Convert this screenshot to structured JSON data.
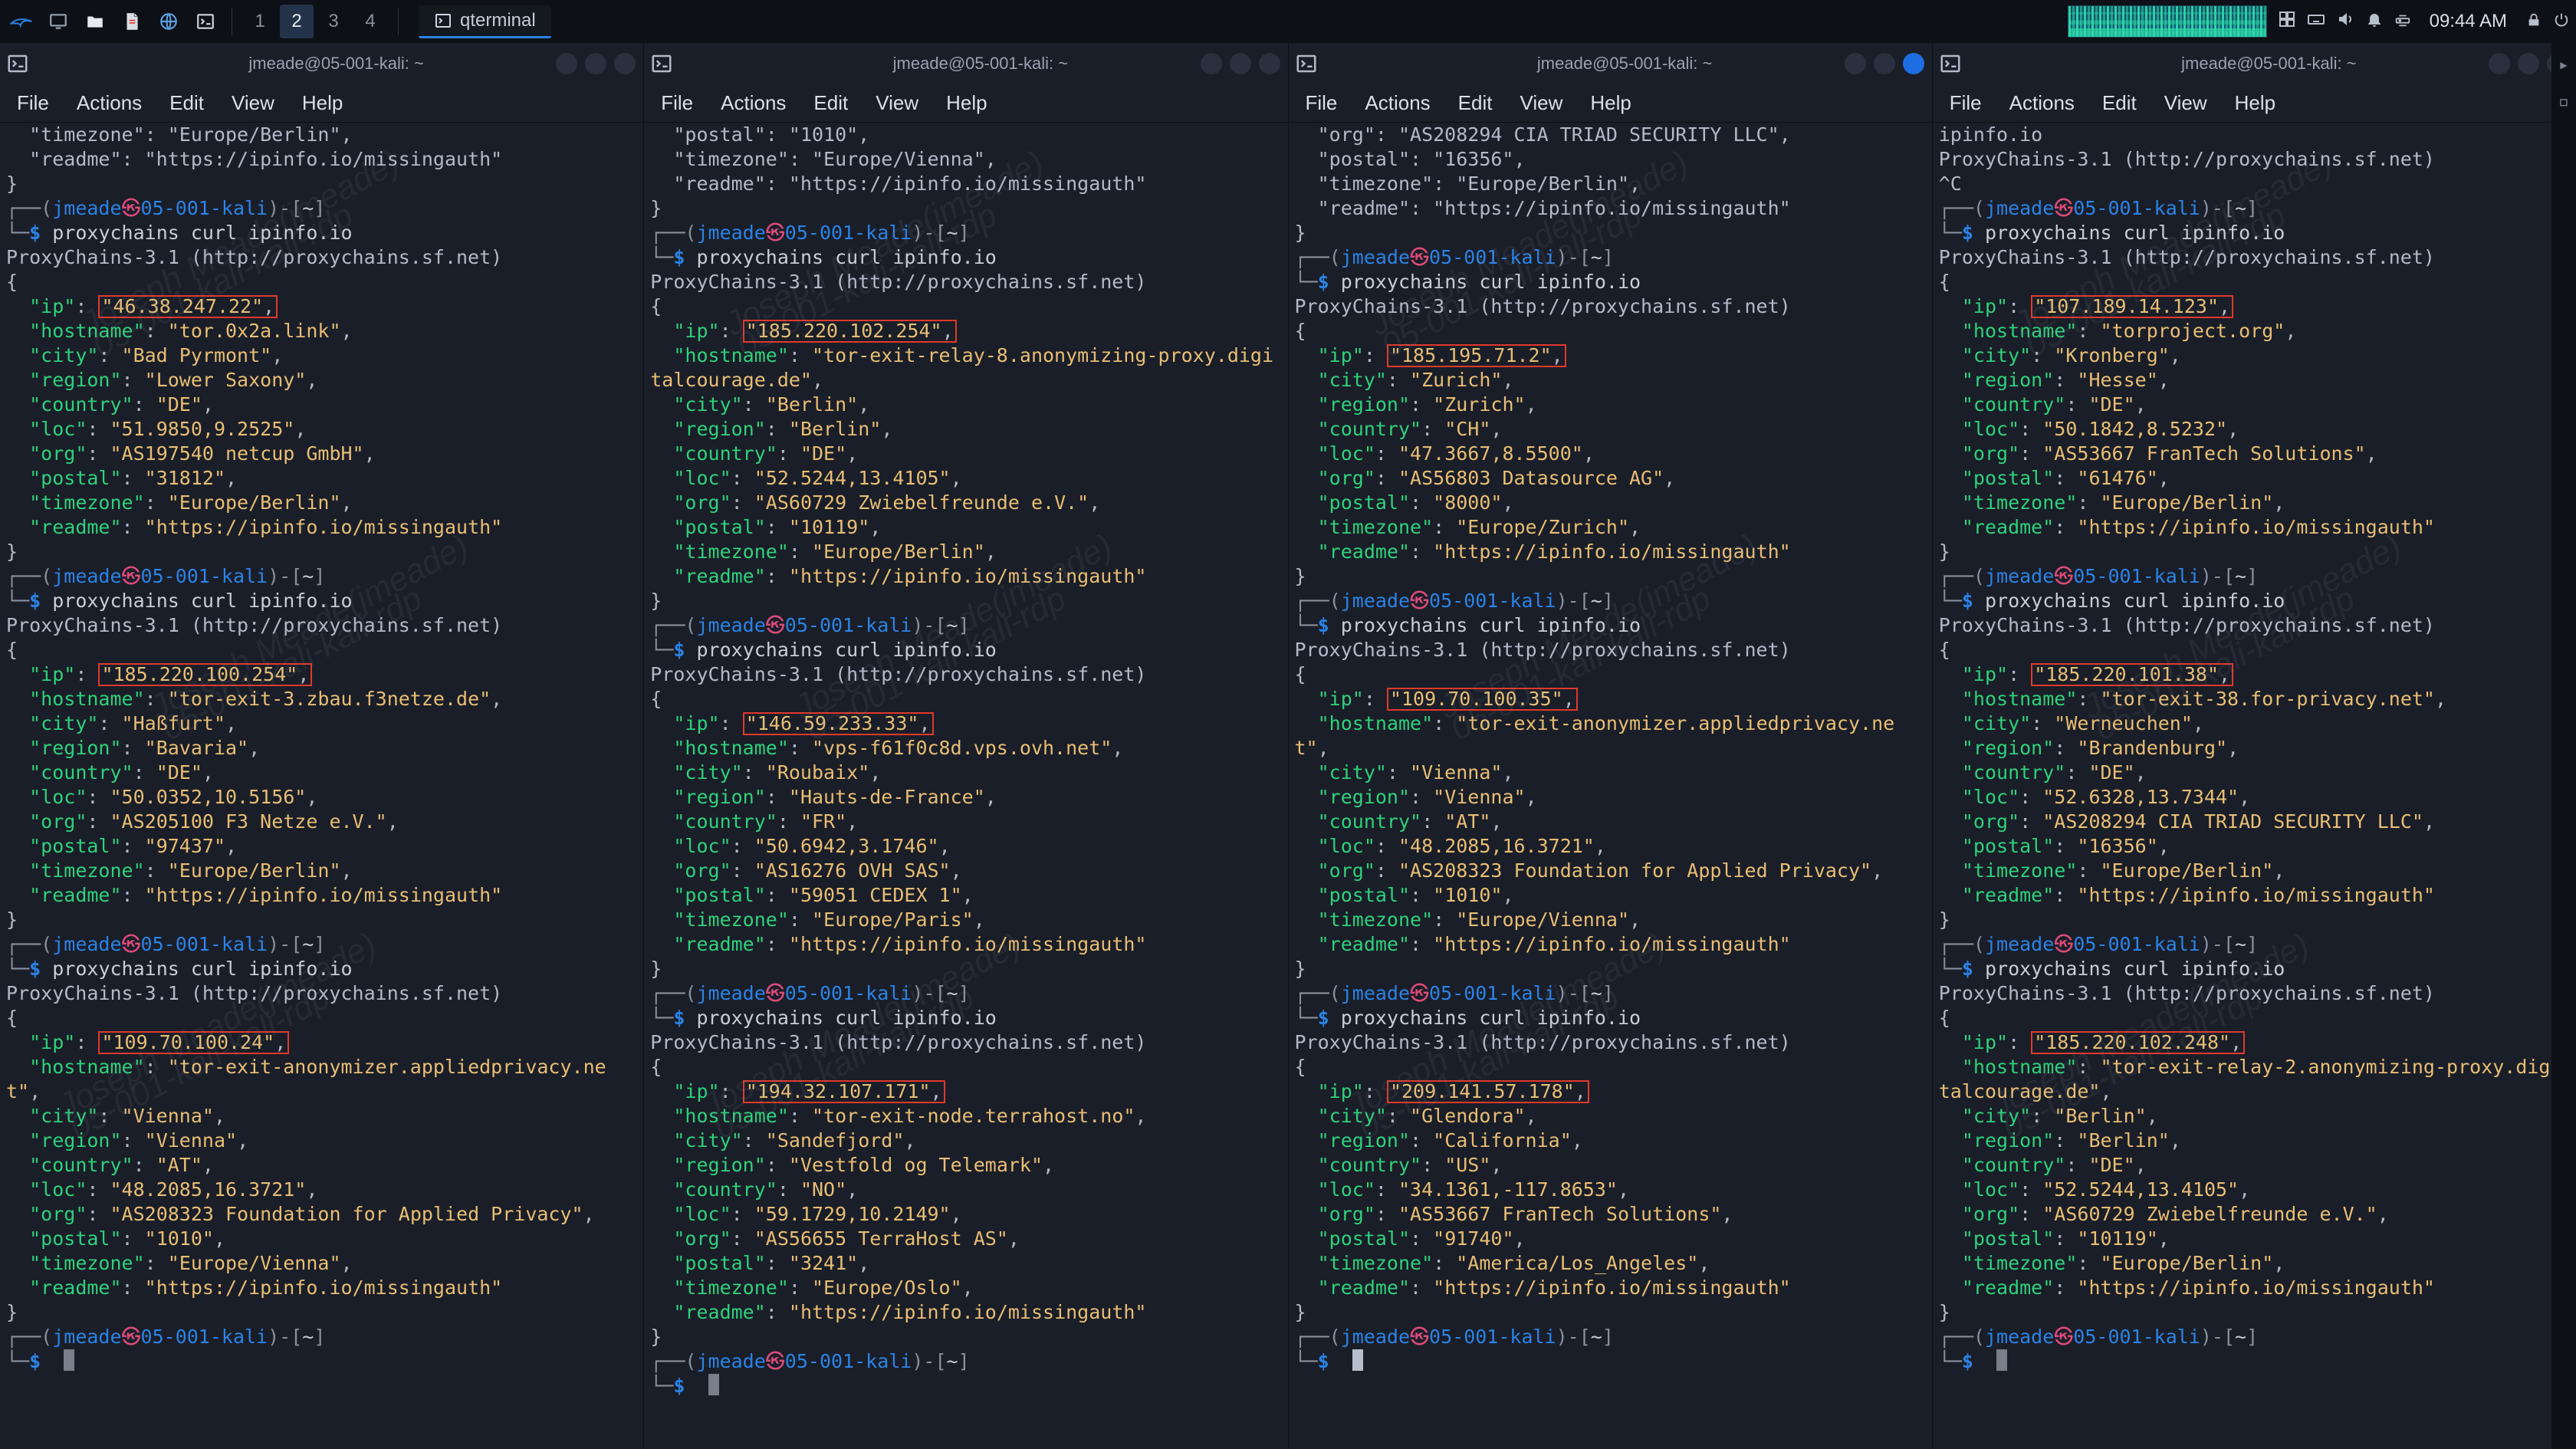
{
  "taskbar": {
    "workspaces": [
      "1",
      "2",
      "3",
      "4"
    ],
    "active_workspace_index": 1,
    "app_title": "qterminal",
    "clock": "09:44 AM"
  },
  "menus": {
    "file": "File",
    "actions": "Actions",
    "edit": "Edit",
    "view": "View",
    "help": "Help"
  },
  "watermark_a": "Joseph Meade(jmeade)",
  "watermark_b": "05-001-kali-kali-rdp",
  "prompt": {
    "user": "jmeade",
    "host": "05-001-kali",
    "path": "~",
    "sigil": "$"
  },
  "command": "proxychains curl ipinfo.io",
  "pc_banner": "ProxyChains-3.1 (http://proxychains.sf.net)",
  "panes": [
    {
      "title": "jmeade@05-001-kali: ~",
      "close_highlight": false,
      "pre_lines": [
        "  \"timezone\": \"Europe/Berlin\",",
        "  \"readme\": \"https://ipinfo.io/missingauth\"",
        "}"
      ],
      "blocks": [
        {
          "ip": "46.38.247.22",
          "fields": [
            [
              "hostname",
              "tor.0x2a.link"
            ],
            [
              "city",
              "Bad Pyrmont"
            ],
            [
              "region",
              "Lower Saxony"
            ],
            [
              "country",
              "DE"
            ],
            [
              "loc",
              "51.9850,9.2525"
            ],
            [
              "org",
              "AS197540 netcup GmbH"
            ],
            [
              "postal",
              "31812"
            ],
            [
              "timezone",
              "Europe/Berlin"
            ],
            [
              "readme",
              "https://ipinfo.io/missingauth"
            ]
          ]
        },
        {
          "ip": "185.220.100.254",
          "fields": [
            [
              "hostname",
              "tor-exit-3.zbau.f3netze.de"
            ],
            [
              "city",
              "Haßfurt"
            ],
            [
              "region",
              "Bavaria"
            ],
            [
              "country",
              "DE"
            ],
            [
              "loc",
              "50.0352,10.5156"
            ],
            [
              "org",
              "AS205100 F3 Netze e.V."
            ],
            [
              "postal",
              "97437"
            ],
            [
              "timezone",
              "Europe/Berlin"
            ],
            [
              "readme",
              "https://ipinfo.io/missingauth"
            ]
          ]
        },
        {
          "ip": "109.70.100.24",
          "fields": [
            [
              "hostname",
              "tor-exit-anonymizer.appliedprivacy.net"
            ],
            [
              "city",
              "Vienna"
            ],
            [
              "region",
              "Vienna"
            ],
            [
              "country",
              "AT"
            ],
            [
              "loc",
              "48.2085,16.3721"
            ],
            [
              "org",
              "AS208323 Foundation for Applied Privacy"
            ],
            [
              "postal",
              "1010"
            ],
            [
              "timezone",
              "Europe/Vienna"
            ],
            [
              "readme",
              "https://ipinfo.io/missingauth"
            ]
          ]
        }
      ],
      "trailing_prompt": true,
      "solid_cursor": false
    },
    {
      "title": "jmeade@05-001-kali: ~",
      "close_highlight": false,
      "pre_lines": [
        "  \"postal\": \"1010\",",
        "  \"timezone\": \"Europe/Vienna\",",
        "  \"readme\": \"https://ipinfo.io/missingauth\"",
        "}"
      ],
      "blocks": [
        {
          "ip": "185.220.102.254",
          "fields": [
            [
              "hostname",
              "tor-exit-relay-8.anonymizing-proxy.digitalcourage.de"
            ],
            [
              "city",
              "Berlin"
            ],
            [
              "region",
              "Berlin"
            ],
            [
              "country",
              "DE"
            ],
            [
              "loc",
              "52.5244,13.4105"
            ],
            [
              "org",
              "AS60729 Zwiebelfreunde e.V."
            ],
            [
              "postal",
              "10119"
            ],
            [
              "timezone",
              "Europe/Berlin"
            ],
            [
              "readme",
              "https://ipinfo.io/missingauth"
            ]
          ]
        },
        {
          "ip": "146.59.233.33",
          "fields": [
            [
              "hostname",
              "vps-f61f0c8d.vps.ovh.net"
            ],
            [
              "city",
              "Roubaix"
            ],
            [
              "region",
              "Hauts-de-France"
            ],
            [
              "country",
              "FR"
            ],
            [
              "loc",
              "50.6942,3.1746"
            ],
            [
              "org",
              "AS16276 OVH SAS"
            ],
            [
              "postal",
              "59051 CEDEX 1"
            ],
            [
              "timezone",
              "Europe/Paris"
            ],
            [
              "readme",
              "https://ipinfo.io/missingauth"
            ]
          ]
        },
        {
          "ip": "194.32.107.171",
          "fields": [
            [
              "hostname",
              "tor-exit-node.terrahost.no"
            ],
            [
              "city",
              "Sandefjord"
            ],
            [
              "region",
              "Vestfold og Telemark"
            ],
            [
              "country",
              "NO"
            ],
            [
              "loc",
              "59.1729,10.2149"
            ],
            [
              "org",
              "AS56655 TerraHost AS"
            ],
            [
              "postal",
              "3241"
            ],
            [
              "timezone",
              "Europe/Oslo"
            ],
            [
              "readme",
              "https://ipinfo.io/missingauth"
            ]
          ]
        }
      ],
      "trailing_prompt": true,
      "solid_cursor": false
    },
    {
      "title": "jmeade@05-001-kali: ~",
      "close_highlight": true,
      "pre_lines": [
        "  \"org\": \"AS208294 CIA TRIAD SECURITY LLC\",",
        "  \"postal\": \"16356\",",
        "  \"timezone\": \"Europe/Berlin\",",
        "  \"readme\": \"https://ipinfo.io/missingauth\"",
        "}"
      ],
      "blocks": [
        {
          "ip": "185.195.71.2",
          "fields": [
            [
              "city",
              "Zurich"
            ],
            [
              "region",
              "Zurich"
            ],
            [
              "country",
              "CH"
            ],
            [
              "loc",
              "47.3667,8.5500"
            ],
            [
              "org",
              "AS56803 Datasource AG"
            ],
            [
              "postal",
              "8000"
            ],
            [
              "timezone",
              "Europe/Zurich"
            ],
            [
              "readme",
              "https://ipinfo.io/missingauth"
            ]
          ]
        },
        {
          "ip": "109.70.100.35",
          "fields": [
            [
              "hostname",
              "tor-exit-anonymizer.appliedprivacy.net"
            ],
            [
              "city",
              "Vienna"
            ],
            [
              "region",
              "Vienna"
            ],
            [
              "country",
              "AT"
            ],
            [
              "loc",
              "48.2085,16.3721"
            ],
            [
              "org",
              "AS208323 Foundation for Applied Privacy"
            ],
            [
              "postal",
              "1010"
            ],
            [
              "timezone",
              "Europe/Vienna"
            ],
            [
              "readme",
              "https://ipinfo.io/missingauth"
            ]
          ]
        },
        {
          "ip": "209.141.57.178",
          "fields": [
            [
              "city",
              "Glendora"
            ],
            [
              "region",
              "California"
            ],
            [
              "country",
              "US"
            ],
            [
              "loc",
              "34.1361,-117.8653"
            ],
            [
              "org",
              "AS53667 FranTech Solutions"
            ],
            [
              "postal",
              "91740"
            ],
            [
              "timezone",
              "America/Los_Angeles"
            ],
            [
              "readme",
              "https://ipinfo.io/missingauth"
            ]
          ]
        }
      ],
      "trailing_prompt": true,
      "solid_cursor": true
    },
    {
      "title": "jmeade@05-001-kali: ~",
      "close_highlight": false,
      "pre_lines": [
        "ipinfo.io",
        "ProxyChains-3.1 (http://proxychains.sf.net)",
        "^C"
      ],
      "blocks": [
        {
          "ip": "107.189.14.123",
          "fields": [
            [
              "hostname",
              "torproject.org"
            ],
            [
              "city",
              "Kronberg"
            ],
            [
              "region",
              "Hesse"
            ],
            [
              "country",
              "DE"
            ],
            [
              "loc",
              "50.1842,8.5232"
            ],
            [
              "org",
              "AS53667 FranTech Solutions"
            ],
            [
              "postal",
              "61476"
            ],
            [
              "timezone",
              "Europe/Berlin"
            ],
            [
              "readme",
              "https://ipinfo.io/missingauth"
            ]
          ]
        },
        {
          "ip": "185.220.101.38",
          "fields": [
            [
              "hostname",
              "tor-exit-38.for-privacy.net"
            ],
            [
              "city",
              "Werneuchen"
            ],
            [
              "region",
              "Brandenburg"
            ],
            [
              "country",
              "DE"
            ],
            [
              "loc",
              "52.6328,13.7344"
            ],
            [
              "org",
              "AS208294 CIA TRIAD SECURITY LLC"
            ],
            [
              "postal",
              "16356"
            ],
            [
              "timezone",
              "Europe/Berlin"
            ],
            [
              "readme",
              "https://ipinfo.io/missingauth"
            ]
          ]
        },
        {
          "ip": "185.220.102.248",
          "fields": [
            [
              "hostname",
              "tor-exit-relay-2.anonymizing-proxy.digitalcourage.de"
            ],
            [
              "city",
              "Berlin"
            ],
            [
              "region",
              "Berlin"
            ],
            [
              "country",
              "DE"
            ],
            [
              "loc",
              "52.5244,13.4105"
            ],
            [
              "org",
              "AS60729 Zwiebelfreunde e.V."
            ],
            [
              "postal",
              "10119"
            ],
            [
              "timezone",
              "Europe/Berlin"
            ],
            [
              "readme",
              "https://ipinfo.io/missingauth"
            ]
          ]
        }
      ],
      "trailing_prompt": true,
      "solid_cursor": false
    }
  ]
}
